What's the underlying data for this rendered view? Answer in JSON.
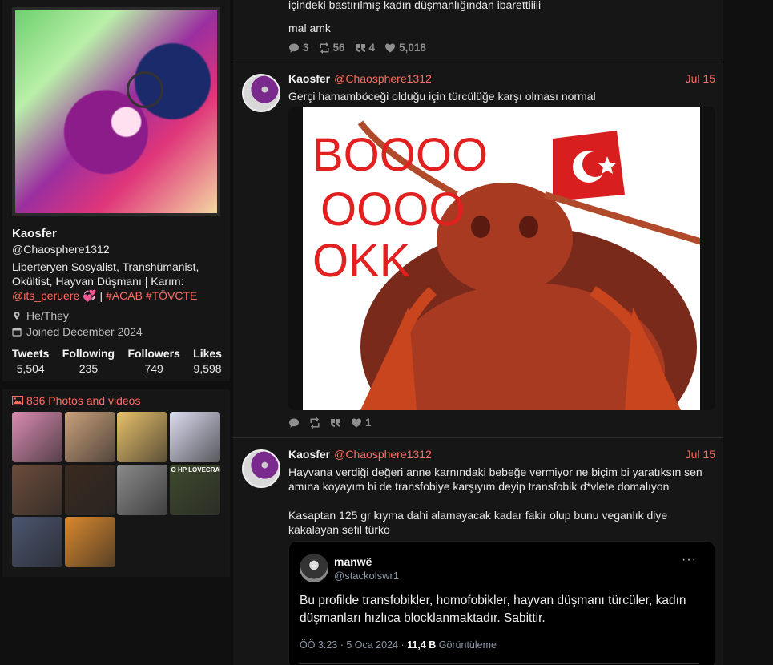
{
  "profile": {
    "name": "Kaosfer",
    "handle": "@Chaosphere1312",
    "bio_line1": "Liberteryen Sosyalist, Transhümanist,",
    "bio_line2": "Okültist, Hayvan Düşmanı | Karım:",
    "bio_mention": "@its_peruere",
    "bio_emoji": "💞",
    "bio_sep": "|",
    "bio_tags": "#ACAB #TÖVCTE",
    "pronouns": "He/They",
    "joined": "Joined December 2024",
    "stats": [
      {
        "label": "Tweets",
        "value": "5,504"
      },
      {
        "label": "Following",
        "value": "235"
      },
      {
        "label": "Followers",
        "value": "749"
      },
      {
        "label": "Likes",
        "value": "9,598"
      }
    ]
  },
  "media": {
    "header": "836 Photos and videos",
    "thumb_colors": [
      "#d98bb0",
      "#c9a07a",
      "#e7c06a",
      "#dcdcf0",
      "#6b4c3a",
      "#3a2a20",
      "#8a8a8a",
      "#3f4a2e",
      "#4a5570",
      "#d9892e"
    ],
    "thumb_captions": [
      "",
      "",
      "",
      "",
      "",
      "",
      "",
      "O HP LOVECRAF",
      "",
      ""
    ]
  },
  "timeline": {
    "tweet1": {
      "text_cut": "içindeki bastırılmış kadın düşmanlığından ibarettiiiii",
      "text": "mal amk",
      "replies": "3",
      "retweets": "56",
      "quotes": "4",
      "likes": "5,018"
    },
    "tweet2": {
      "name": "Kaosfer",
      "handle": "@Chaosphere1312",
      "date": "Jul 15",
      "text": "Gerçi hamamböceği olduğu için türcülüğe karşı olması normal",
      "meme_l1": "BOOOO",
      "meme_l2": "OOOO",
      "meme_l3": "OKK",
      "likes": "1"
    },
    "tweet3": {
      "name": "Kaosfer",
      "handle": "@Chaosphere1312",
      "date": "Jul 15",
      "text1": "Hayvana verdiği değeri anne karnındaki bebeğe vermiyor ne biçim bi yaratıksın sen amına koyayım bi de transfobiye karşıyım deyip transfobik d*vlete domalıyon",
      "text2": "Kasaptan 125 gr kıyma dahi alamayacak kadar fakir olup bunu veganlık diye kakalayan sefil türko",
      "quote": {
        "name": "manwë",
        "handle": "@stackolswr1",
        "more": "···",
        "text": "Bu profilde transfobikler, homofobikler, hayvan düşmanı türcüler, kadın düşmanları hızlıca blocklanmaktadır. Sabittir.",
        "meta_time": "ÖÖ 3:23 · 5 Oca 2024 · ",
        "meta_views": "11,4 B",
        "meta_views_label": " Görüntüleme"
      }
    }
  },
  "colors": {
    "accent": "#ff6c60",
    "panel": "#161616",
    "background": "#0f0f0f"
  }
}
